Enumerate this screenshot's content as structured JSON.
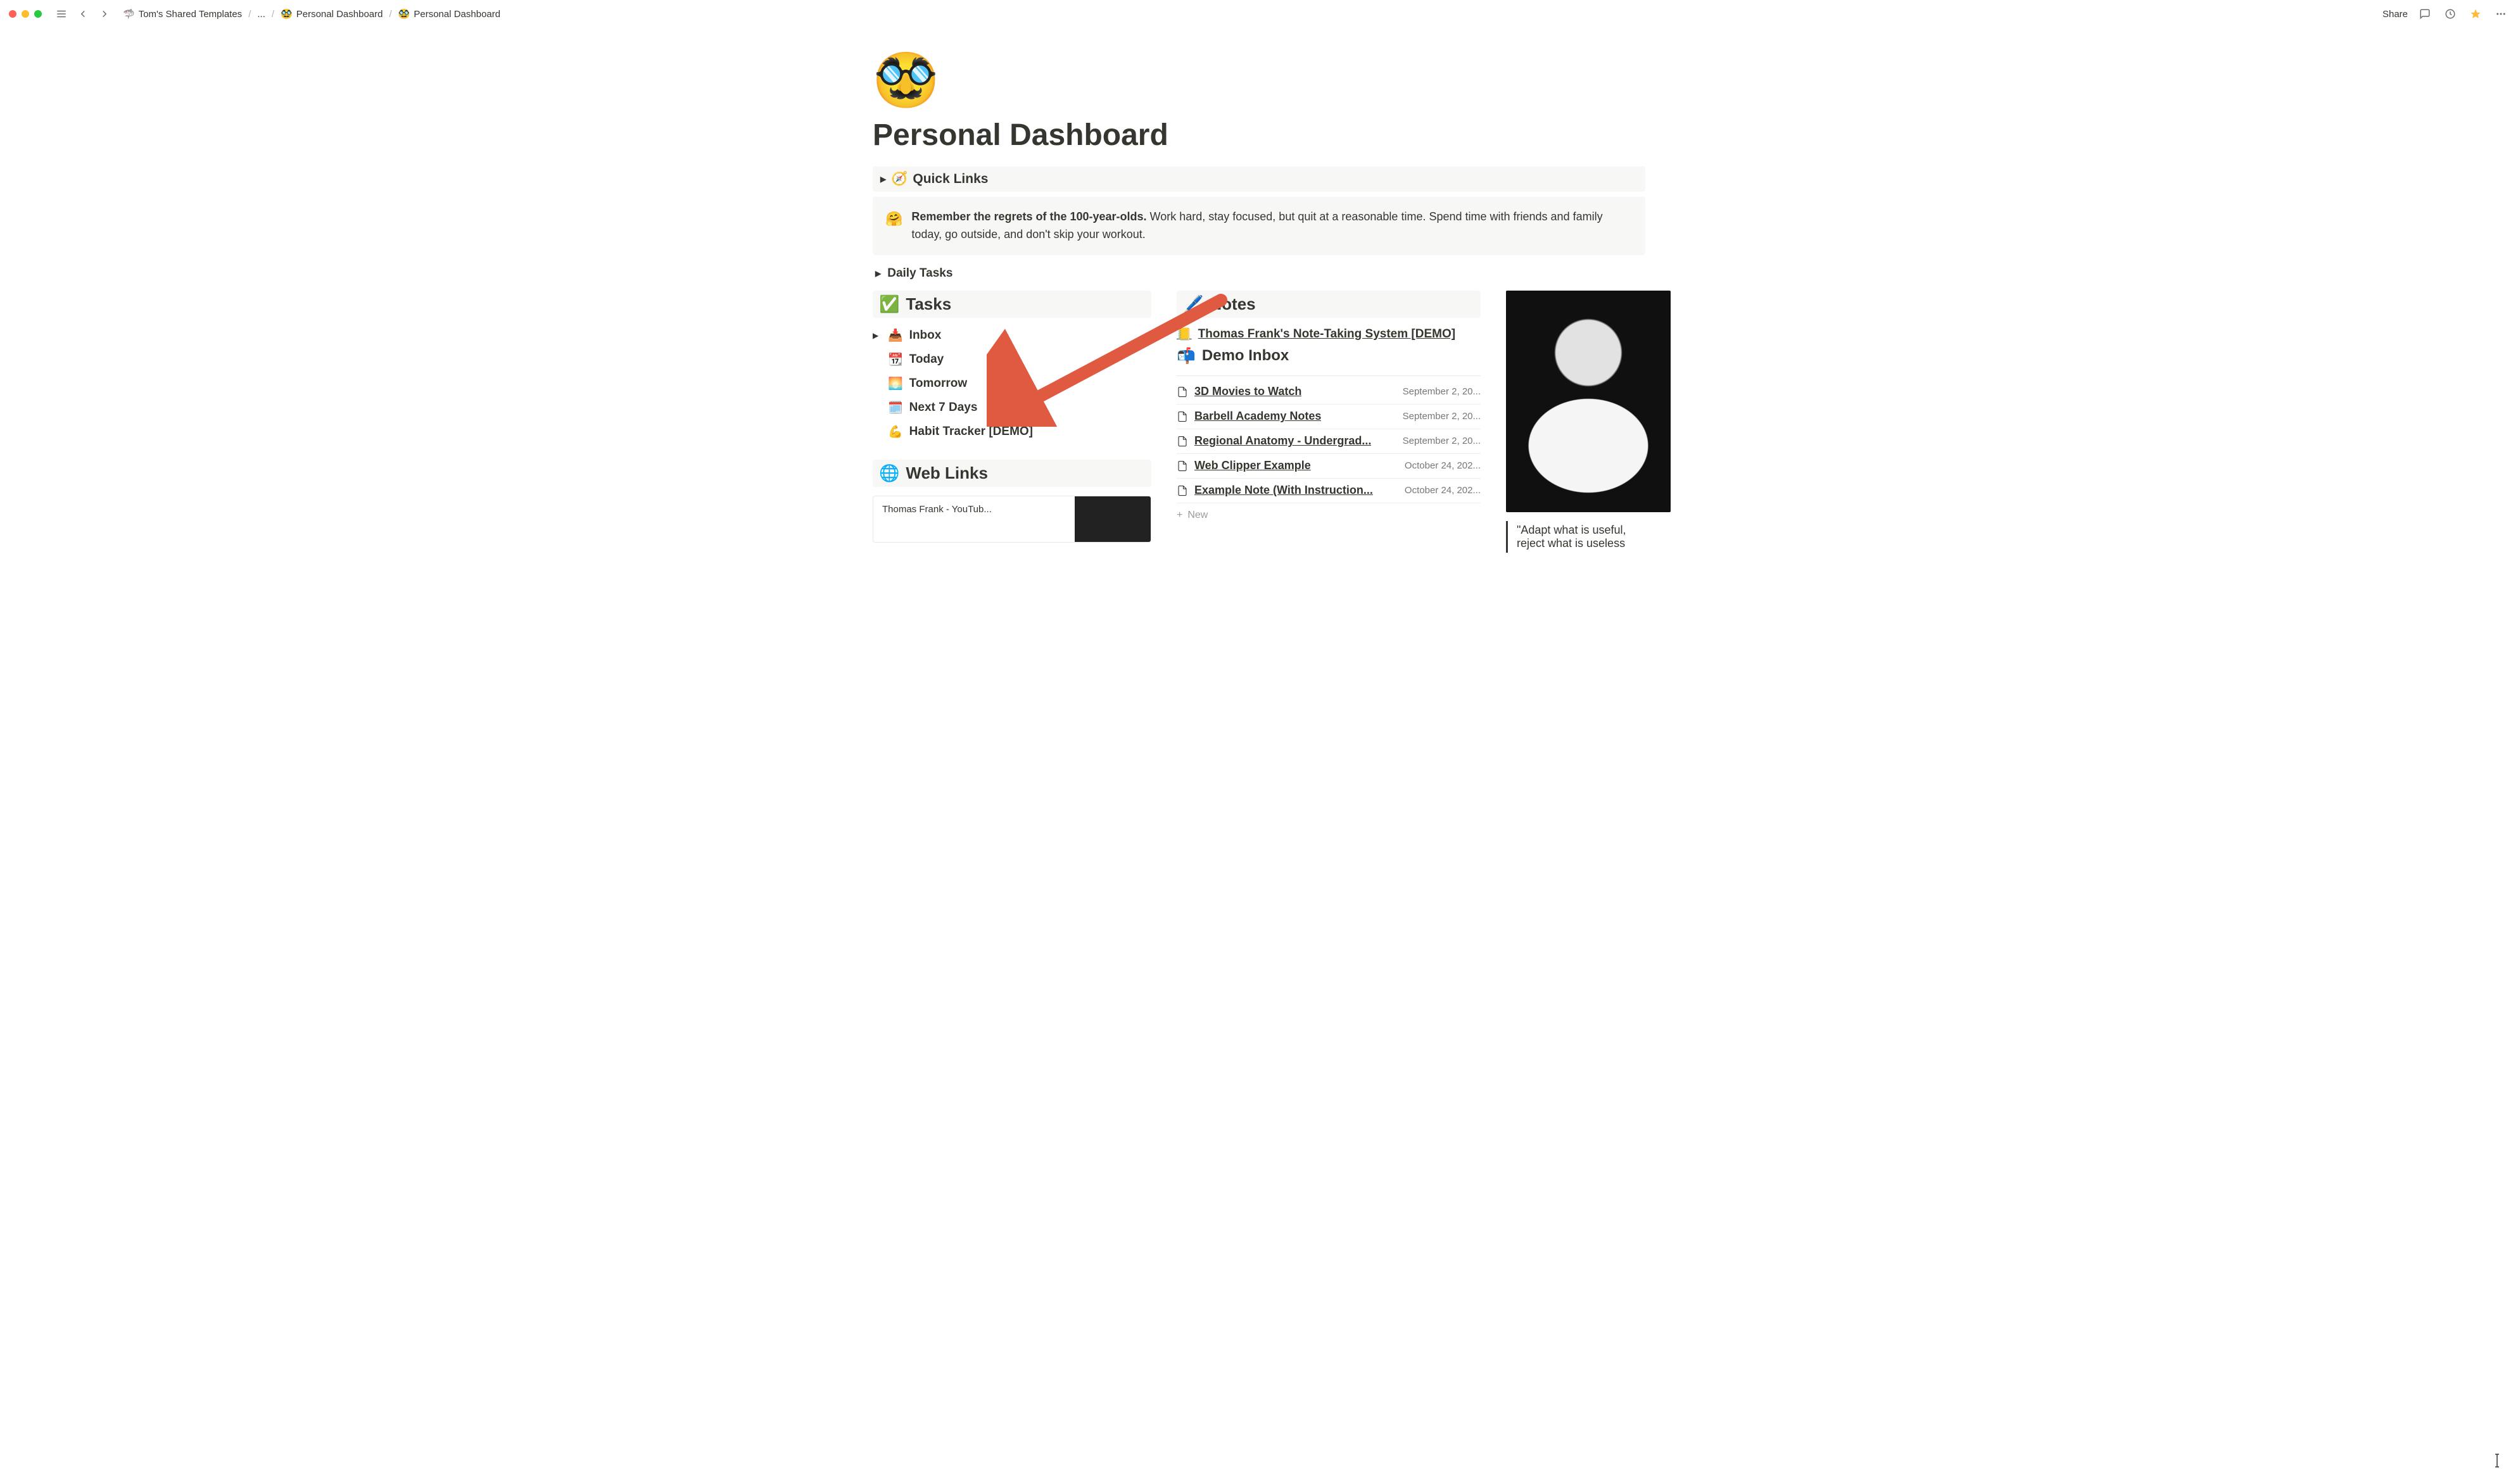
{
  "traffic": {},
  "breadcrumb": {
    "root_icon": "🦈",
    "root": "Tom's Shared Templates",
    "ellipsis": "...",
    "mid_icon": "🥸",
    "mid": "Personal Dashboard",
    "leaf_icon": "🥸",
    "leaf": "Personal Dashboard"
  },
  "topbar": {
    "share": "Share"
  },
  "page": {
    "emoji": "🥸",
    "title": "Personal Dashboard"
  },
  "quick_links": {
    "icon": "🧭",
    "label": "Quick Links"
  },
  "callout": {
    "emoji": "🤗",
    "bold": "Remember the regrets of the 100-year-olds.",
    "rest": " Work hard, stay focused, but quit at a reasonable time. Spend time with friends and family today, go outside, and don't skip your workout."
  },
  "daily_tasks": {
    "label": "Daily Tasks"
  },
  "tasks": {
    "head_icon": "✅",
    "head": "Tasks",
    "items": [
      {
        "icon": "📥",
        "label": "Inbox",
        "toggle": true
      },
      {
        "icon": "📆",
        "label": "Today",
        "toggle": false
      },
      {
        "icon": "🌅",
        "label": "Tomorrow",
        "toggle": false
      },
      {
        "icon": "🗓️",
        "label": "Next 7 Days",
        "toggle": false
      },
      {
        "icon": "💪",
        "label": "Habit Tracker [DEMO]",
        "toggle": false
      }
    ]
  },
  "web": {
    "head_icon": "🌐",
    "head": "Web Links",
    "card_title": "Thomas Frank - YouTub..."
  },
  "notes": {
    "head_icon": "🖊️",
    "head": "Notes",
    "top_link_icon": "📒",
    "top_link": "Thomas Frank's Note-Taking System [DEMO]",
    "inbox_icon": "📬",
    "inbox": "Demo Inbox",
    "rows": [
      {
        "title": "3D Movies to Watch",
        "date": "September 2, 20..."
      },
      {
        "title": "Barbell Academy Notes",
        "date": "September 2, 20..."
      },
      {
        "title": "Regional Anatomy - Undergrad...",
        "date": "September 2, 20..."
      },
      {
        "title": "Web Clipper Example",
        "date": "October 24, 202..."
      },
      {
        "title": "Example Note (With Instruction...",
        "date": "October 24, 202..."
      }
    ],
    "new": "New"
  },
  "quote": {
    "line1": "\"Adapt what is useful,",
    "line2": "reject what is useless"
  }
}
